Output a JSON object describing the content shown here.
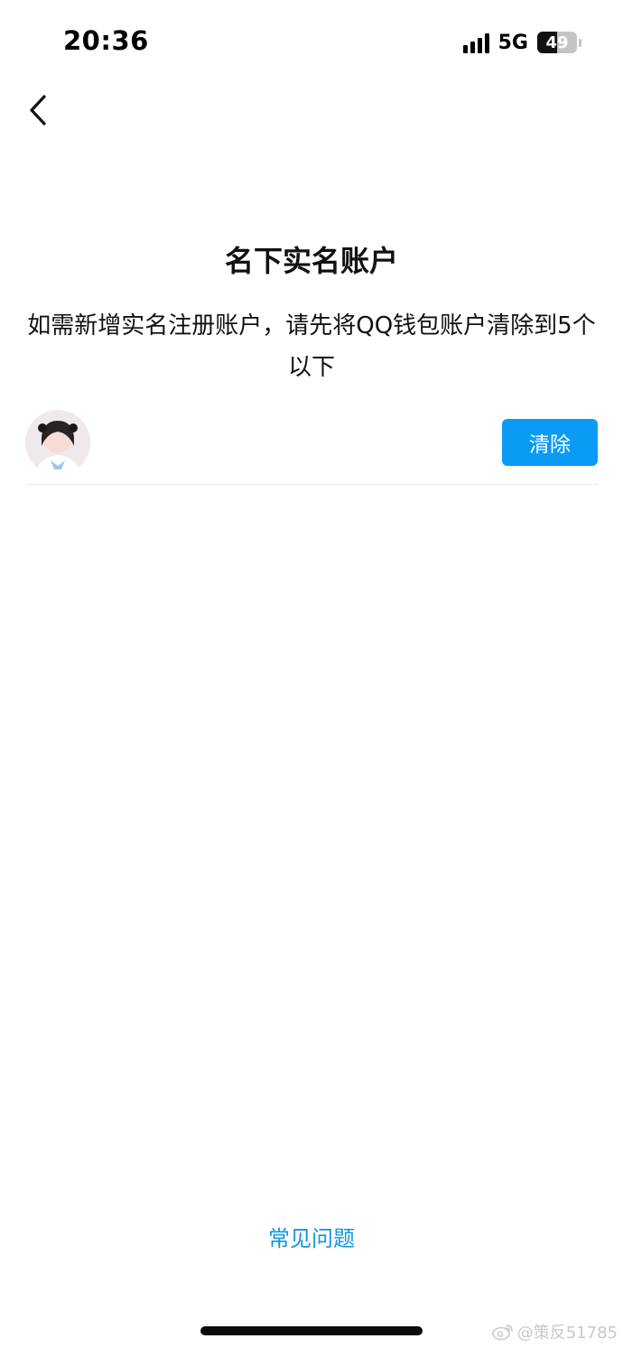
{
  "status_bar": {
    "time": "20:36",
    "network": "5G",
    "battery_percent": 49,
    "battery_label": "49"
  },
  "header": {
    "back_icon": "chevron-left-icon"
  },
  "main": {
    "title": "名下实名账户",
    "description": "如需新增实名注册账户，请先将QQ钱包账户清除到5个以下",
    "accounts": [
      {
        "avatar": "user-avatar",
        "action_label": "清除"
      }
    ]
  },
  "footer": {
    "faq_label": "常见问题"
  },
  "watermark": {
    "icon": "weibo-icon",
    "text": "@策反51785"
  },
  "colors": {
    "accent": "#0a9bf5",
    "link": "#1296db",
    "divider": "#ececec"
  }
}
